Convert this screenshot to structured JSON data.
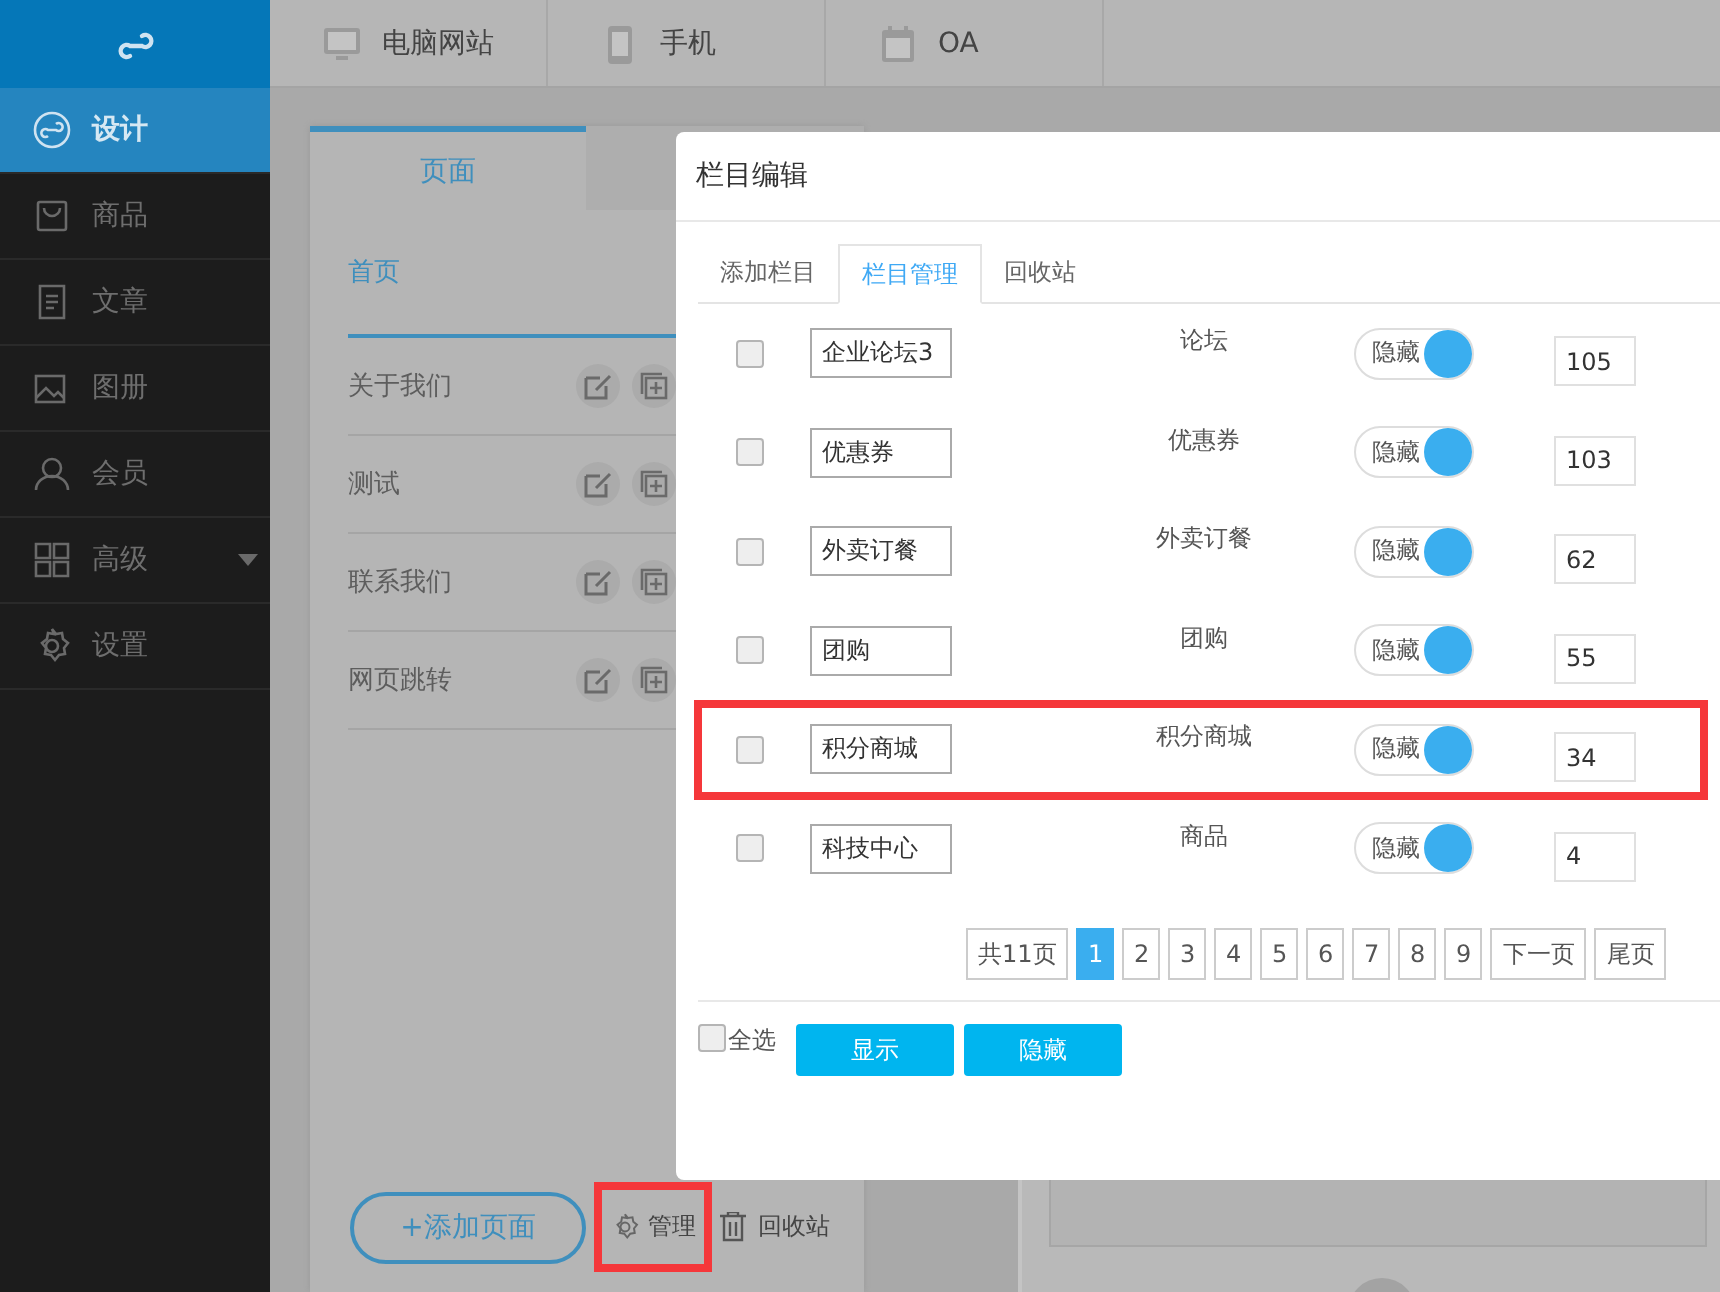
{
  "sidebar": {
    "items": [
      {
        "kind": "design",
        "label": "设计",
        "selected": true,
        "caret": false
      },
      {
        "kind": "goods",
        "label": "商品",
        "selected": false,
        "caret": false
      },
      {
        "kind": "article",
        "label": "文章",
        "selected": false,
        "caret": false
      },
      {
        "kind": "album",
        "label": "图册",
        "selected": false,
        "caret": false
      },
      {
        "kind": "member",
        "label": "会员",
        "selected": false,
        "caret": false
      },
      {
        "kind": "advanced",
        "label": "高级",
        "selected": false,
        "caret": true
      },
      {
        "kind": "settings",
        "label": "设置",
        "selected": false,
        "caret": false
      }
    ]
  },
  "top_tabs": [
    {
      "kind": "monitor",
      "label": "电脑网站"
    },
    {
      "kind": "phone",
      "label": "手机"
    },
    {
      "kind": "calendar",
      "label": "OA"
    }
  ],
  "pages_panel": {
    "tab": "页面",
    "pages": [
      {
        "label": "首页",
        "selected": true
      },
      {
        "label": "关于我们",
        "selected": false
      },
      {
        "label": "测试",
        "selected": false
      },
      {
        "label": "联系我们",
        "selected": false
      },
      {
        "label": "网页跳转",
        "selected": false
      }
    ],
    "add_button": "+添加页面",
    "manage": {
      "label": "管理",
      "highlighted": true
    },
    "recycle": "回收站"
  },
  "dialog": {
    "title": "栏目编辑",
    "tabs": [
      {
        "label": "添加栏目",
        "selected": false
      },
      {
        "label": "栏目管理",
        "selected": true
      },
      {
        "label": "回收站",
        "selected": false
      }
    ],
    "rows": [
      {
        "checked": false,
        "name": "企业论坛3",
        "type": "论坛",
        "toggle_label": "隐藏",
        "on": true,
        "order": "105",
        "highlighted": false
      },
      {
        "checked": false,
        "name": "优惠券",
        "type": "优惠券",
        "toggle_label": "隐藏",
        "on": true,
        "order": "103",
        "highlighted": false
      },
      {
        "checked": false,
        "name": "外卖订餐",
        "type": "外卖订餐",
        "toggle_label": "隐藏",
        "on": true,
        "order": "62",
        "highlighted": false
      },
      {
        "checked": false,
        "name": "团购",
        "type": "团购",
        "toggle_label": "隐藏",
        "on": true,
        "order": "55",
        "highlighted": false
      },
      {
        "checked": false,
        "name": "积分商城",
        "type": "积分商城",
        "toggle_label": "隐藏",
        "on": true,
        "order": "34",
        "highlighted": true
      },
      {
        "checked": false,
        "name": "科技中心",
        "type": "商品",
        "toggle_label": "隐藏",
        "on": true,
        "order": "4",
        "highlighted": false
      }
    ],
    "pagination": {
      "total": "共11页",
      "pages": [
        {
          "label": "1",
          "selected": true
        },
        {
          "label": "2",
          "selected": false
        },
        {
          "label": "3",
          "selected": false
        },
        {
          "label": "4",
          "selected": false
        },
        {
          "label": "5",
          "selected": false
        },
        {
          "label": "6",
          "selected": false
        },
        {
          "label": "7",
          "selected": false
        },
        {
          "label": "8",
          "selected": false
        },
        {
          "label": "9",
          "selected": false
        }
      ],
      "next": "下一页",
      "last": "尾页"
    },
    "select_all": {
      "label": "全选",
      "checked": false
    },
    "buttons": [
      "显示",
      "隐藏"
    ]
  }
}
